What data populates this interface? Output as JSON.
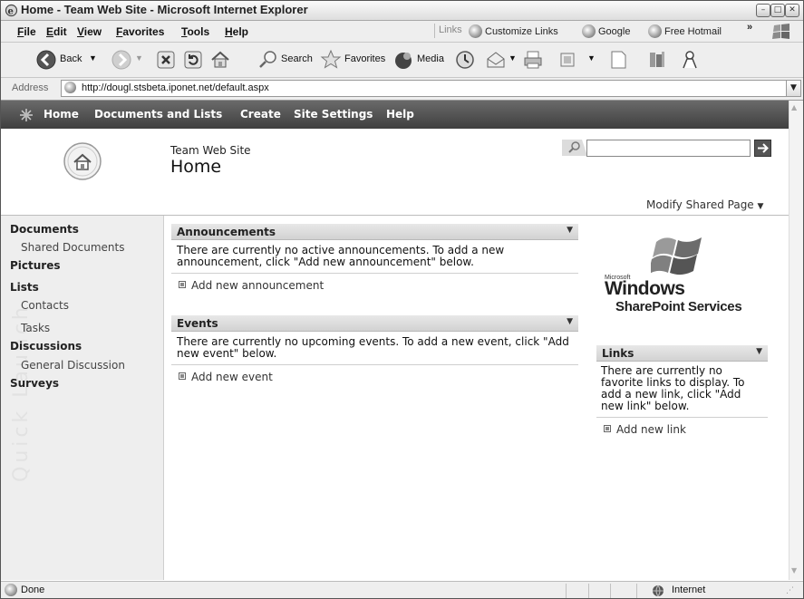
{
  "window": {
    "title": "Home - Team Web Site - Microsoft Internet Explorer"
  },
  "menu": {
    "items": [
      "File",
      "Edit",
      "View",
      "Favorites",
      "Tools",
      "Help"
    ]
  },
  "links_bar": {
    "label": "Links",
    "items": [
      "Customize Links",
      "Google",
      "Free Hotmail"
    ],
    "more": "»"
  },
  "toolbar": {
    "back_label": "Back",
    "search_label": "Search",
    "favorites_label": "Favorites",
    "media_label": "Media"
  },
  "address": {
    "label": "Address",
    "url": "http://dougl.stsbeta.iponet.net/default.aspx"
  },
  "sp_nav": {
    "items": [
      "Home",
      "Documents and Lists",
      "Create",
      "Site Settings",
      "Help"
    ]
  },
  "site": {
    "name": "Team Web Site",
    "page_title": "Home",
    "modify_label": "Modify Shared Page"
  },
  "quick_launch": {
    "watermark": "Quick Launch",
    "sections": [
      {
        "heading": "Documents",
        "items": [
          "Shared Documents"
        ]
      },
      {
        "heading": "Pictures",
        "items": []
      },
      {
        "heading": "Lists",
        "items": [
          "Contacts",
          "Tasks"
        ]
      },
      {
        "heading": "Discussions",
        "items": [
          "General Discussion"
        ]
      },
      {
        "heading": "Surveys",
        "items": []
      }
    ]
  },
  "announcements": {
    "title": "Announcements",
    "message": "There are currently no active announcements. To add a new announcement, click \"Add new announcement\" below.",
    "add_link": "Add new announcement"
  },
  "events": {
    "title": "Events",
    "message": "There are currently no upcoming events. To add a new event, click \"Add new event\" below.",
    "add_link": "Add new event"
  },
  "logo": {
    "microsoft": "Microsoft",
    "windows": "Windows",
    "product": "SharePoint Services"
  },
  "links_part": {
    "title": "Links",
    "message": "There are currently no favorite links to display. To add a new link, click \"Add new link\" below.",
    "add_link": "Add new link"
  },
  "status": {
    "left": "Done",
    "zone": "Internet"
  },
  "icons": [
    "ie-logo-icon",
    "back-icon",
    "forward-icon",
    "stop-icon",
    "refresh-icon",
    "home-icon",
    "search-icon",
    "favorites-icon",
    "media-icon",
    "history-icon",
    "mail-icon",
    "print-icon",
    "edit-icon",
    "discuss-icon",
    "research-icon",
    "messenger-icon",
    "go-icon",
    "windows-flag-icon",
    "site-home-icon",
    "globe-icon"
  ]
}
